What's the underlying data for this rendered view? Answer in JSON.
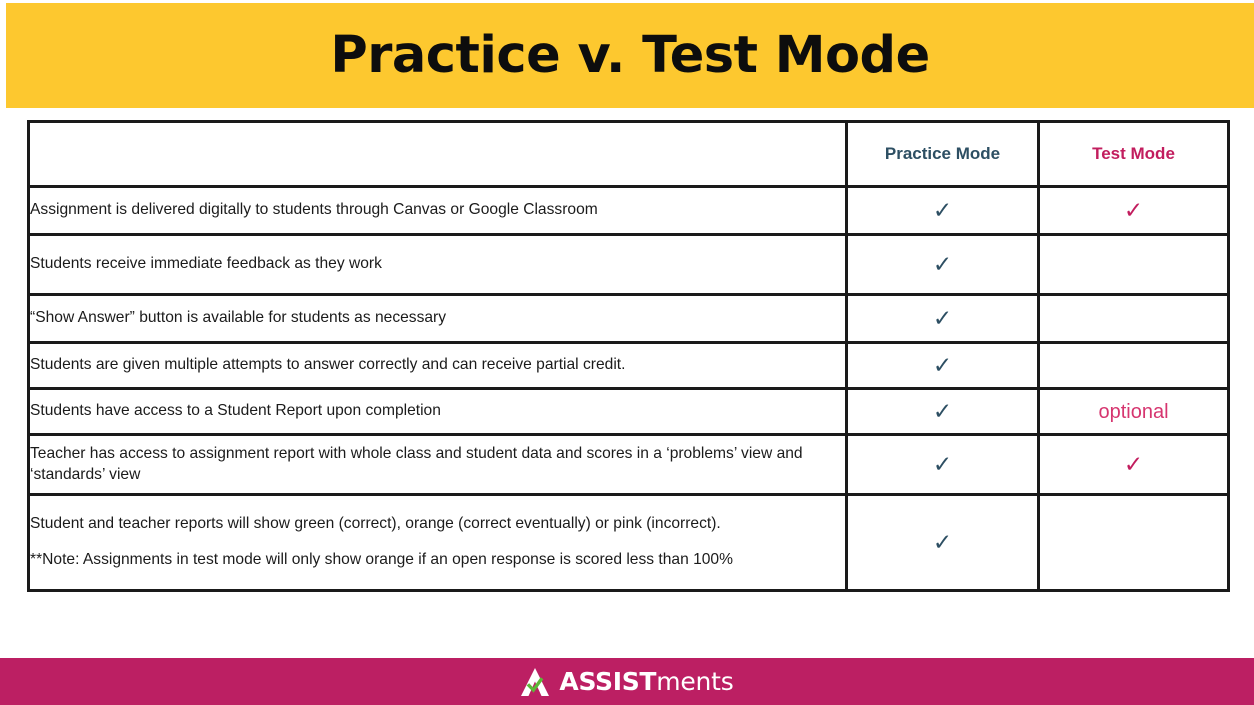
{
  "slide": {
    "title": "Practice v. Test Mode",
    "theme": {
      "banner_bg": "#fdc82f",
      "footer_bg": "#bc1f63",
      "practice_accent": "#2d4f63",
      "test_accent": "#c21d5e",
      "optional_accent": "#d6356f",
      "border": "#1a1a1a",
      "page_bg": "#ffffff"
    }
  },
  "table": {
    "columns": [
      {
        "key": "feature",
        "label": ""
      },
      {
        "key": "practice",
        "label": "Practice Mode"
      },
      {
        "key": "test",
        "label": "Test Mode"
      }
    ],
    "check_glyph": "✓",
    "rows": [
      {
        "feature": "Assignment is delivered digitally to students through Canvas or Google Classroom",
        "practice": "✓",
        "test": "✓"
      },
      {
        "feature": "Students receive immediate feedback as they work",
        "practice": "✓",
        "test": ""
      },
      {
        "feature": "“Show Answer” button is available for students as necessary",
        "practice": "✓",
        "test": ""
      },
      {
        "feature": "Students are given multiple attempts to answer correctly and can receive partial credit.",
        "practice": "✓",
        "test": ""
      },
      {
        "feature": "Students have access to a Student Report upon completion",
        "practice": "✓",
        "test": "optional"
      },
      {
        "feature": "Teacher has access to assignment report with whole class and student data and scores in a ‘problems’ view and ‘standards’ view",
        "practice": "✓",
        "test": "✓"
      },
      {
        "feature": "Student and teacher reports will show green (correct), orange (correct eventually) or pink (incorrect).",
        "feature_note": "**Note:  Assignments in test mode will only show orange if an open response is scored less than 100%",
        "practice": "✓",
        "test": ""
      }
    ]
  },
  "footer": {
    "logo_bold": "ASSIST",
    "logo_light": "ments"
  }
}
